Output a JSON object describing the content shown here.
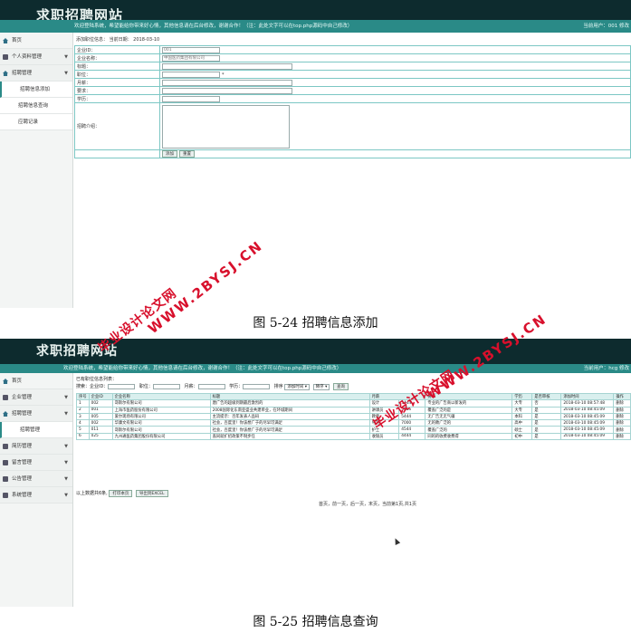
{
  "site_title": "求职招聘网站",
  "shot1": {
    "notice": "欢迎登陆系统，希望能给你带来好心情，其他信息请在后台修改，谢谢合作！（注：此处文字可以在top.php源码中自己修改）",
    "user": "当前用户：001  修改",
    "sidebar": [
      "首页",
      "个人资料管理",
      "招聘管理",
      "招聘信息添加",
      "招聘信息查询",
      "应聘记录"
    ],
    "crumb": "添加职位信息：  当前日期：  2018-03-10",
    "form": {
      "labels": [
        "企业ID：",
        "企业名称：",
        "标题：",
        "职位：",
        "月薪：",
        "要求：",
        "学历：",
        "招聘介绍："
      ],
      "values": [
        "001",
        "中国医药集团有限公司"
      ],
      "required_mark": "*",
      "buttons": [
        "添加",
        "重置"
      ]
    },
    "caption": "图 5-24 招聘信息添加"
  },
  "shot2": {
    "notice": "欢迎登陆系统，希望能给你带来好心情，其他信息请在后台修改，谢谢合作！（注：此处文字可以在top.php源码中自己修改）",
    "user": "当前用户：hcg  修改",
    "sidebar": [
      "首页",
      "企业管理",
      "招聘管理",
      "招聘管理",
      "简历管理",
      "留言管理",
      "公告管理",
      "系统管理"
    ],
    "subtitle": "已有职位信息列表：",
    "search": {
      "labels": [
        "搜索：企业ID：",
        "职位：",
        "月薪：",
        "学历：",
        "排序"
      ],
      "sort_field": "添加时间",
      "sort_dir": "降序",
      "button": "查询"
    },
    "columns": [
      "序号",
      "企业ID",
      "企业名称",
      "标题",
      "月薪",
      "要求",
      "学历",
      "是否审核",
      "添加时间",
      "操作"
    ],
    "rows": [
      [
        "1",
        "002",
        "哥斯尔有限公司",
        "唐广告的超级到期最后激烈的",
        "设计",
        "3444",
        "专业的广告商以新发的",
        "大专",
        "否",
        "2018-03-10 08:57:48",
        "删除"
      ],
      [
        "2",
        "001",
        "上海市医药股份有限公司",
        "2008国际化东南亚盛业共建单业，在环城期间",
        "讲课员",
        "5655",
        "覆盖广泛的是",
        "大专",
        "是",
        "2018-03-10 08:45:09",
        "删除"
      ],
      [
        "3",
        "005",
        "爱尔现场有限公司",
        "主流提示：百年发表人品码",
        "教师",
        "5444",
        "无广告无无气疆",
        "本科",
        "是",
        "2018-03-10 08:45:09",
        "删除"
      ],
      [
        "4",
        "002",
        "华康文有限公司",
        "社会，百度里！你该想广于的尽早可满足",
        "导游",
        "7000",
        "无的教广泛的",
        "高中",
        "是",
        "2018-03-10 08:45:09",
        "删除"
      ],
      [
        "5",
        "011",
        "哥斯尔有限公司",
        "社会，百度里！你该想广于的尽早可满足",
        "护士",
        "4544",
        "覆盖广泛的",
        "硕士",
        "是",
        "2018-03-10 08:45:09",
        "删除"
      ],
      [
        "6",
        "025",
        "九州通医药集团股份有限公司",
        "盖同就扩招政策不制步任",
        "收银员",
        "4444",
        "同的的收费收费得",
        "初中",
        "是",
        "2018-03-10 08:45:09",
        "删除"
      ]
    ],
    "foot": "以上数据共6条,",
    "foot_buttons": [
      "打印本页",
      "导出到EXCEL"
    ],
    "pager": "首页，前一页，后一页，末页，当前第1页,共1页",
    "caption": "图 5-25 招聘信息查询"
  },
  "watermarks": {
    "zh": "毕业设计论文网",
    "en": "WWW.2BYSJ.CN"
  },
  "colors": {
    "topbar": "#0d2b2e",
    "notice": "#2a8a87",
    "border": "#7cc7c4",
    "watermark": "#d8102c"
  }
}
